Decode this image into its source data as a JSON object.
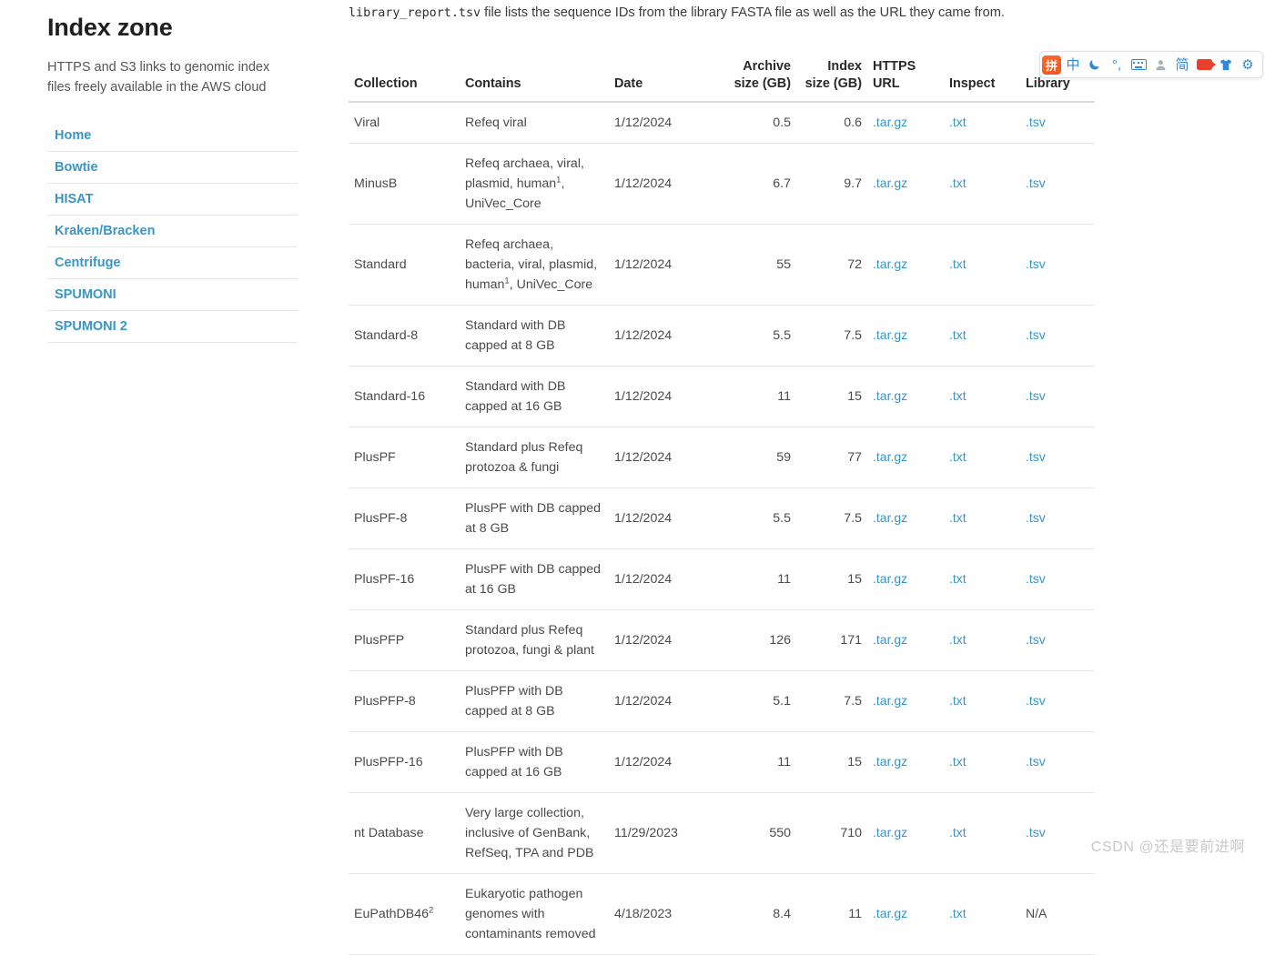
{
  "sidebar": {
    "title": "Index zone",
    "description": "HTTPS and S3 links to genomic index files freely available in the AWS cloud",
    "nav": [
      {
        "label": "Home"
      },
      {
        "label": "Bowtie"
      },
      {
        "label": "HISAT"
      },
      {
        "label": "Kraken/Bracken"
      },
      {
        "label": "Centrifuge"
      },
      {
        "label": "SPUMONI"
      },
      {
        "label": "SPUMONI 2"
      }
    ]
  },
  "main": {
    "intro_code": "library_report.tsv",
    "intro_text": " file lists the sequence IDs from the library FASTA file as well as the URL they came from.",
    "table": {
      "columns": [
        {
          "key": "collection",
          "label": "Collection"
        },
        {
          "key": "contains",
          "label": "Contains"
        },
        {
          "key": "date",
          "label": "Date"
        },
        {
          "key": "archive",
          "label": "Archive size (GB)"
        },
        {
          "key": "index",
          "label": "Index size (GB)"
        },
        {
          "key": "https",
          "label": "HTTPS URL"
        },
        {
          "key": "inspect",
          "label": "Inspect"
        },
        {
          "key": "library",
          "label": "Library"
        }
      ],
      "link_labels": {
        "https": ".tar.gz",
        "inspect": ".txt",
        "library": ".tsv",
        "na": "N/A"
      },
      "rows": [
        {
          "collection": "Viral",
          "collection_sup": "",
          "contains": "Refeq viral",
          "contains_sup_after": "",
          "date": "1/12/2024",
          "archive": "0.5",
          "index": "0.6",
          "https": ".tar.gz",
          "inspect": ".txt",
          "library": ".tsv"
        },
        {
          "collection": "MinusB",
          "collection_sup": "",
          "contains_pre": "Refeq archaea, viral, plasmid, human",
          "contains_sup": "1",
          "contains_post": ", UniVec_Core",
          "date": "1/12/2024",
          "archive": "6.7",
          "index": "9.7",
          "https": ".tar.gz",
          "inspect": ".txt",
          "library": ".tsv"
        },
        {
          "collection": "Standard",
          "collection_sup": "",
          "contains_pre": "Refeq archaea, bacteria, viral, plasmid, human",
          "contains_sup": "1",
          "contains_post": ", UniVec_Core",
          "date": "1/12/2024",
          "archive": "55",
          "index": "72",
          "https": ".tar.gz",
          "inspect": ".txt",
          "library": ".tsv"
        },
        {
          "collection": "Standard-8",
          "collection_sup": "",
          "contains": "Standard with DB capped at 8 GB",
          "date": "1/12/2024",
          "archive": "5.5",
          "index": "7.5",
          "https": ".tar.gz",
          "inspect": ".txt",
          "library": ".tsv"
        },
        {
          "collection": "Standard-16",
          "collection_sup": "",
          "contains": "Standard with DB capped at 16 GB",
          "date": "1/12/2024",
          "archive": "11",
          "index": "15",
          "https": ".tar.gz",
          "inspect": ".txt",
          "library": ".tsv"
        },
        {
          "collection": "PlusPF",
          "collection_sup": "",
          "contains": "Standard plus Refeq protozoa & fungi",
          "date": "1/12/2024",
          "archive": "59",
          "index": "77",
          "https": ".tar.gz",
          "inspect": ".txt",
          "library": ".tsv"
        },
        {
          "collection": "PlusPF-8",
          "collection_sup": "",
          "contains": "PlusPF with DB capped at 8 GB",
          "date": "1/12/2024",
          "archive": "5.5",
          "index": "7.5",
          "https": ".tar.gz",
          "inspect": ".txt",
          "library": ".tsv"
        },
        {
          "collection": "PlusPF-16",
          "collection_sup": "",
          "contains": "PlusPF with DB capped at 16 GB",
          "date": "1/12/2024",
          "archive": "11",
          "index": "15",
          "https": ".tar.gz",
          "inspect": ".txt",
          "library": ".tsv"
        },
        {
          "collection": "PlusPFP",
          "collection_sup": "",
          "contains": "Standard plus Refeq protozoa, fungi & plant",
          "date": "1/12/2024",
          "archive": "126",
          "index": "171",
          "https": ".tar.gz",
          "inspect": ".txt",
          "library": ".tsv"
        },
        {
          "collection": "PlusPFP-8",
          "collection_sup": "",
          "contains": "PlusPFP with DB capped at 8 GB",
          "date": "1/12/2024",
          "archive": "5.1",
          "index": "7.5",
          "https": ".tar.gz",
          "inspect": ".txt",
          "library": ".tsv"
        },
        {
          "collection": "PlusPFP-16",
          "collection_sup": "",
          "contains": "PlusPFP with DB capped at 16 GB",
          "date": "1/12/2024",
          "archive": "11",
          "index": "15",
          "https": ".tar.gz",
          "inspect": ".txt",
          "library": ".tsv"
        },
        {
          "collection": "nt Database",
          "collection_sup": "",
          "contains": "Very large collection, inclusive of GenBank, RefSeq, TPA and PDB",
          "date": "11/29/2023",
          "archive": "550",
          "index": "710",
          "https": ".tar.gz",
          "inspect": ".txt",
          "library": ".tsv"
        },
        {
          "collection": "EuPathDB46",
          "collection_sup": "2",
          "contains": "Eukaryotic pathogen genomes with contaminants removed",
          "date": "4/18/2023",
          "archive": "8.4",
          "index": "11",
          "https": ".tar.gz",
          "inspect": ".txt",
          "library": "N/A"
        }
      ]
    }
  },
  "ime_toolbar": {
    "items": [
      {
        "name": "sogou-logo-icon",
        "glyph": "拼",
        "kind": "logo"
      },
      {
        "name": "chinese-mode-icon",
        "glyph": "中",
        "kind": "text"
      },
      {
        "name": "moon-icon",
        "glyph": "☽",
        "kind": "moon"
      },
      {
        "name": "punctuation-icon",
        "glyph": "°,",
        "kind": "text"
      },
      {
        "name": "soft-keyboard-icon",
        "glyph": "",
        "kind": "keyboard"
      },
      {
        "name": "user-account-icon",
        "glyph": "●",
        "kind": "person"
      },
      {
        "name": "simplified-chinese-icon",
        "glyph": "简",
        "kind": "text"
      },
      {
        "name": "screen-recorder-icon",
        "glyph": "",
        "kind": "video"
      },
      {
        "name": "skin-theme-icon",
        "glyph": "☘",
        "kind": "shirt"
      },
      {
        "name": "settings-gear-icon",
        "glyph": "⚙",
        "kind": "text"
      }
    ]
  },
  "watermark": {
    "text": "CSDN @还是要前进啊"
  },
  "colors": {
    "link": "#3a95c7",
    "text": "#4a4a4a",
    "heading": "#1f1f1f",
    "ime_blue": "#2f89d8",
    "ime_orange": "#f4511e",
    "border": "#e6e6e6"
  }
}
